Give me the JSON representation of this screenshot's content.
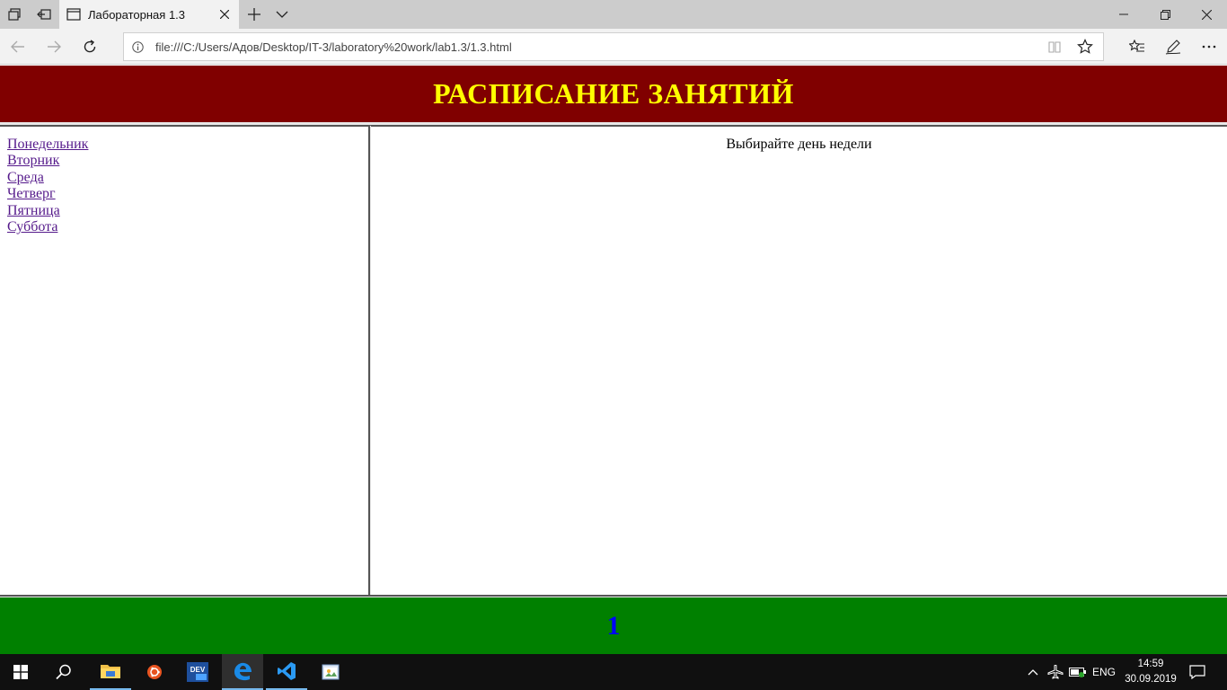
{
  "browser": {
    "tab_title": "Лабораторная 1.3",
    "url": "file:///C:/Users/Адов/Desktop/IT-3/laboratory%20work/lab1.3/1.3.html"
  },
  "page": {
    "header_title": "РАСПИСАНИЕ ЗАНЯТИЙ",
    "nav_links": [
      {
        "label": "Понедельник"
      },
      {
        "label": "Вторник"
      },
      {
        "label": "Среда"
      },
      {
        "label": "Четверг"
      },
      {
        "label": "Пятница"
      },
      {
        "label": "Суббота"
      }
    ],
    "main_text": "Выбирайте день недели",
    "footer_text": "1"
  },
  "colors": {
    "header_bg": "#800000",
    "header_text": "#ffff00",
    "footer_bg": "#008000",
    "footer_text": "#0000ff",
    "link_visited": "#551a8b"
  },
  "taskbar": {
    "icons": [
      "windows-start-icon",
      "search-icon",
      "file-explorer-icon",
      "ubuntu-icon",
      "dev-icon",
      "edge-icon",
      "vscode-icon",
      "paint-icon"
    ],
    "language": "ENG",
    "time": "14:59",
    "date": "30.09.2019"
  }
}
